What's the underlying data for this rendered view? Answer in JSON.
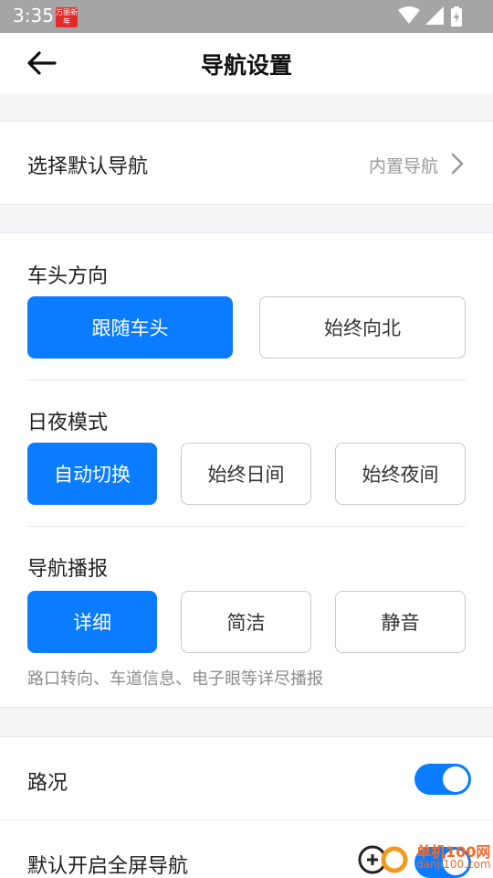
{
  "status_bar": {
    "time": "3:35",
    "app_badge": "万丽新年"
  },
  "header": {
    "title": "导航设置"
  },
  "default_nav": {
    "label": "选择默认导航",
    "value": "内置导航"
  },
  "heading_direction": {
    "title": "车头方向",
    "options": [
      "跟随车头",
      "始终向北"
    ],
    "selected": "跟随车头"
  },
  "day_night": {
    "title": "日夜模式",
    "options": [
      "自动切换",
      "始终日间",
      "始终夜间"
    ],
    "selected": "自动切换"
  },
  "broadcast": {
    "title": "导航播报",
    "options": [
      "详细",
      "简洁",
      "静音"
    ],
    "selected": "详细",
    "hint": "路口转向、车道信息、电子眼等详尽播报"
  },
  "traffic": {
    "label": "路况",
    "enabled": true
  },
  "fullscreen": {
    "label": "默认开启全屏导航",
    "enabled": true
  },
  "watermark": {
    "title": "单机100网",
    "site": "danji100.com"
  },
  "colors": {
    "accent": "#0a7cff",
    "status_bar": "#a5a5a5",
    "badge": "#e32b2b"
  }
}
